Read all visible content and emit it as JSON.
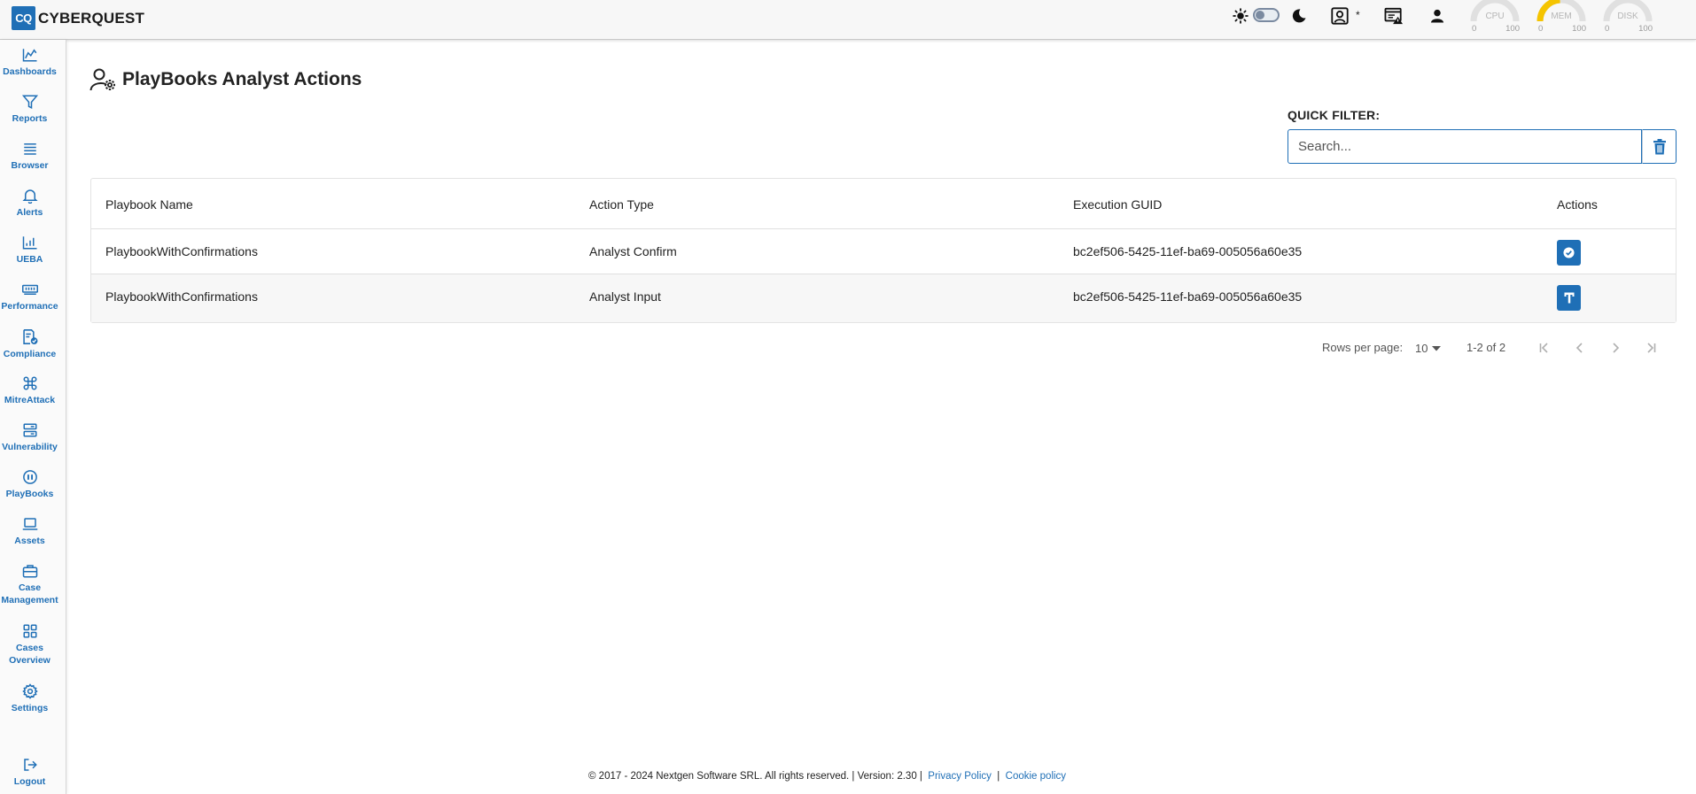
{
  "header": {
    "logo_mark": "CQ",
    "logo_text": "CYBERQUEST",
    "notification_marker": "*",
    "gauges": [
      {
        "label": "CPU",
        "min": "0",
        "max": "100",
        "value": 0
      },
      {
        "label": "MEM",
        "min": "0",
        "max": "100",
        "value": 48
      },
      {
        "label": "DISK",
        "min": "0",
        "max": "100",
        "value": 0
      }
    ],
    "colors": {
      "gauge_track": "#e0e0e0",
      "gauge_fill": "#f5c400"
    }
  },
  "sidebar": {
    "items": [
      {
        "label": "Dashboards",
        "icon": "area-chart-icon"
      },
      {
        "label": "Reports",
        "icon": "filter-icon"
      },
      {
        "label": "Browser",
        "icon": "list-icon"
      },
      {
        "label": "Alerts",
        "icon": "bell-icon"
      },
      {
        "label": "UEBA",
        "icon": "bar-chart-icon"
      },
      {
        "label": "Performance",
        "icon": "memory-icon"
      },
      {
        "label": "Compliance",
        "icon": "document-check-icon"
      },
      {
        "label": "MitreAttack",
        "icon": "command-icon"
      },
      {
        "label": "Vulnerability",
        "icon": "server-icon"
      },
      {
        "label": "PlayBooks",
        "icon": "pause-circle-icon"
      },
      {
        "label": "Assets",
        "icon": "laptop-icon"
      },
      {
        "label": "Case Management",
        "icon": "briefcase-icon"
      },
      {
        "label": "Cases Overview",
        "icon": "grid-icon"
      },
      {
        "label": "Settings",
        "icon": "gear-icon"
      }
    ],
    "logout_label": "Logout"
  },
  "main": {
    "title": "PlayBooks Analyst Actions",
    "quick_filter_label": "QUICK FILTER:",
    "search_placeholder": "Search...",
    "table": {
      "columns": [
        "Playbook Name",
        "Action Type",
        "Execution GUID",
        "Actions"
      ],
      "rows": [
        {
          "playbook": "PlaybookWithConfirmations",
          "action_type": "Analyst Confirm",
          "guid": "bc2ef506-5425-11ef-ba69-005056a60e35",
          "action_icon": "check-circle-icon"
        },
        {
          "playbook": "PlaybookWithConfirmations",
          "action_type": "Analyst Input",
          "guid": "bc2ef506-5425-11ef-ba69-005056a60e35",
          "action_icon": "text-input-icon"
        }
      ]
    },
    "pagination": {
      "rows_per_page_label": "Rows per page:",
      "rows_per_page_value": "10",
      "range_text": "1-2 of 2"
    }
  },
  "footer": {
    "text": "© 2017 - 2024 Nextgen Software SRL. All rights reserved. | Version: 2.30 |",
    "privacy_link": "Privacy Policy",
    "separator": "|",
    "cookie_link": "Cookie policy"
  },
  "colors": {
    "accent": "#1f6fb6"
  }
}
